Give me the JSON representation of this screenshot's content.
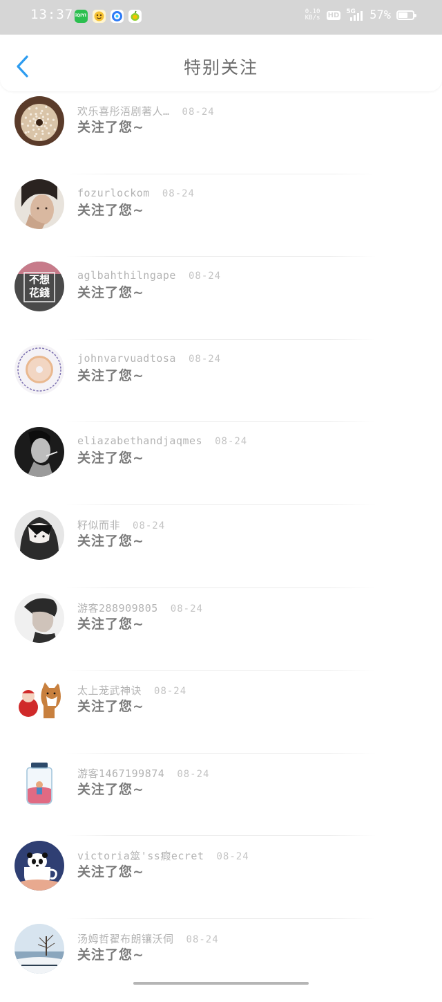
{
  "status_bar": {
    "time": "13:37",
    "apps": [
      {
        "name": "iqiyi-app-icon",
        "label": "iQIYI",
        "color": "#2bbf4f"
      },
      {
        "name": "face-app-icon",
        "label": "",
        "color": "#f6c232"
      },
      {
        "name": "qq-browser-app-icon",
        "label": "",
        "color": "#2e7bf6"
      },
      {
        "name": "lemon-app-icon",
        "label": "",
        "color": "#f8c200"
      }
    ],
    "net_speed_value": "0.10",
    "net_speed_unit": "KB/s",
    "hd_label": "HD",
    "network_type": "5G",
    "battery_percent": "57%",
    "battery_level": 0.57
  },
  "header": {
    "back_icon": "chevron-left-icon",
    "title": "特别关注",
    "accent_color": "#2d9cf0"
  },
  "items": [
    {
      "name": "欢乐喜彤浯剧著人…",
      "date": "08-24",
      "action": "关注了您~",
      "avatar": "sea-urchin"
    },
    {
      "name": "fozurlockom",
      "date": "08-24",
      "action": "关注了您~",
      "avatar": "man-portrait"
    },
    {
      "name": "aglbahthilngape",
      "date": "08-24",
      "action": "关注了您~",
      "avatar": "calligraphy",
      "avatar_text_1": "不想",
      "avatar_text_2": "花錢"
    },
    {
      "name": "johnvarvuadtosa",
      "date": "08-24",
      "action": "关注了您~",
      "avatar": "stamp-donut"
    },
    {
      "name": "eliazabethandjaqmes",
      "date": "08-24",
      "action": "关注了您~",
      "avatar": "smoking-man"
    },
    {
      "name": "籽似而非",
      "date": "08-24",
      "action": "关注了您~",
      "avatar": "anime-hood"
    },
    {
      "name": "游客288909805",
      "date": "08-24",
      "action": "关注了您~",
      "avatar": "profile-boy"
    },
    {
      "name": "太上茏武神诀",
      "date": "08-24",
      "action": "关注了您~",
      "avatar": "baby-dog"
    },
    {
      "name": "游客1467199874",
      "date": "08-24",
      "action": "关注了您~",
      "avatar": "jar"
    },
    {
      "name": "victoria筮'ss瘕ecret",
      "date": "08-24",
      "action": "关注了您~",
      "avatar": "panda-cup"
    },
    {
      "name": "汤姆哲翟布朗镶沃伺",
      "date": "08-24",
      "action": "关注了您~",
      "avatar": "winter-tree"
    }
  ]
}
